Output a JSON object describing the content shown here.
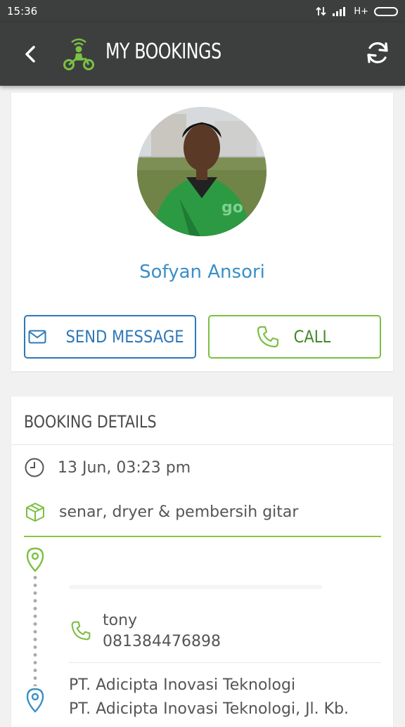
{
  "status_bar": {
    "time": "15:36",
    "network": "H+"
  },
  "app_bar": {
    "title": "MY BOOKINGS",
    "back_icon": "chevron-left-icon",
    "logo_icon": "motorbike-driver-icon",
    "refresh_icon": "refresh-icon"
  },
  "driver": {
    "name": "Sofyan Ansori",
    "send_message_label": "SEND MESSAGE",
    "call_label": "CALL"
  },
  "booking_details": {
    "header": "BOOKING DETAILS",
    "time": "13 Jun, 03:23 pm",
    "item": "senar, dryer & pembersih gitar",
    "contact_name": "tony",
    "contact_phone": "081384476898",
    "destination_title": "PT. Adicipta Inovasi Teknologi",
    "destination_address": "PT. Adicipta Inovasi Teknologi, Jl. Kb."
  },
  "colors": {
    "app_bar": "#3d3f3e",
    "accent_green": "#7bc043",
    "accent_blue": "#2e78b7",
    "name_blue": "#3a8fc7"
  }
}
